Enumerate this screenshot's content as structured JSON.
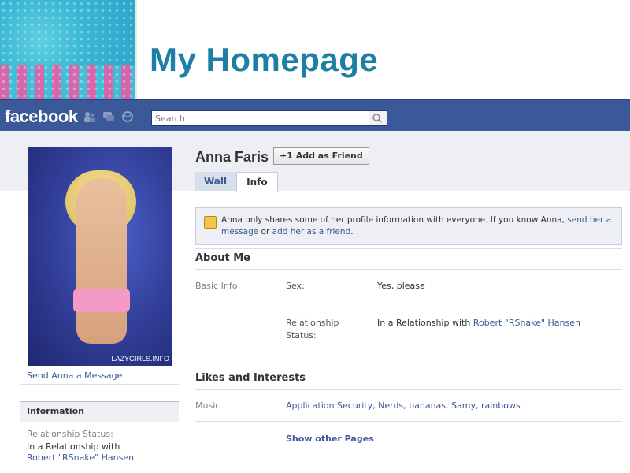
{
  "slide": {
    "title": "My Homepage"
  },
  "topbar": {
    "logo": "facebook",
    "search_placeholder": "Search",
    "icons": [
      "friends-icon",
      "messages-icon",
      "globe-icon",
      "search-icon"
    ]
  },
  "profile": {
    "name": "Anna Faris",
    "add_friend_label": "Add as Friend",
    "photo_watermark": "LAZYGIRLS.INFO",
    "send_message": "Send Anna a Message",
    "tabs": [
      {
        "label": "Wall"
      },
      {
        "label": "Info"
      }
    ]
  },
  "notice": {
    "text": "Anna only shares some of her profile information with everyone. If you know Anna,",
    "link1": "send her a message",
    "mid": "or",
    "link2": "add her as a friend",
    "end": "."
  },
  "about": {
    "heading": "About Me",
    "basic_info_label": "Basic Info",
    "sex_label": "Sex:",
    "sex_value": "Yes, please",
    "rel_label_1": "Relationship",
    "rel_label_2": "Status:",
    "rel_value_prefix": "In a Relationship with",
    "rel_value_link": "Robert \"RSnake\" Hansen"
  },
  "likes": {
    "heading": "Likes and Interests",
    "music_label": "Music",
    "music_value": "Application Security, Nerds, bananas, Samy, rainbows",
    "show_more": "Show other Pages"
  },
  "sidebar": {
    "info_heading": "Information",
    "rel_label": "Relationship Status:",
    "rel_value": "In a Relationship with",
    "rel_link": "Robert \"RSnake\" Hansen"
  },
  "colors": {
    "fb_blue": "#3b5998",
    "title_teal": "#1d7fa3",
    "panel_grey": "#edeff4"
  }
}
